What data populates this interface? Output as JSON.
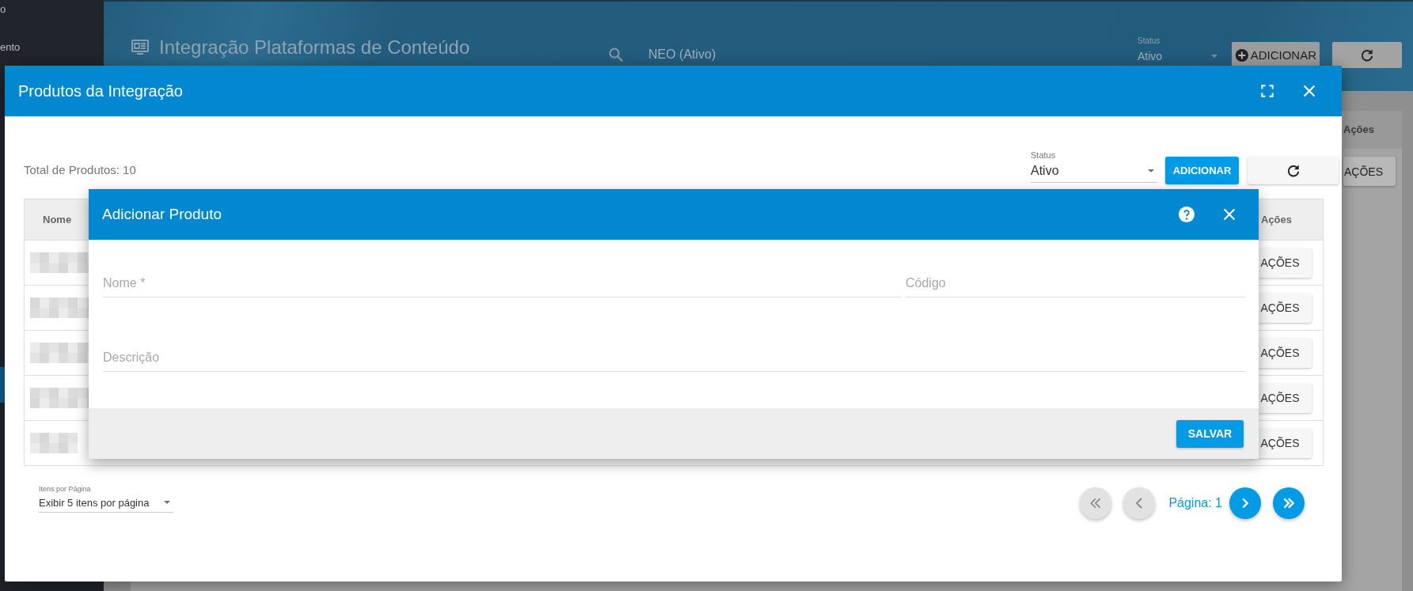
{
  "sidebar": {
    "items": [
      {
        "label": "o",
        "selected": false
      },
      {
        "label": "ento",
        "selected": false
      },
      {
        "selected": true
      }
    ]
  },
  "page": {
    "title": "Integração Plataformas de Conteúdo",
    "search_value": "NEO (Ativo)",
    "status": {
      "label": "Status",
      "value": "Ativo"
    },
    "add_button": "ADICIONAR",
    "table": {
      "columns": [
        "Ações"
      ],
      "rows": [
        {
          "action": "AÇÕES"
        }
      ]
    }
  },
  "products_dialog": {
    "title": "Produtos da Integração",
    "total": "Total de Produtos: 10",
    "status": {
      "label": "Status",
      "value": "Ativo"
    },
    "add_button": "ADICIONAR",
    "table": {
      "columns": [
        "Nome",
        "Ações"
      ],
      "rows": [
        {
          "action": "AÇÕES"
        },
        {
          "action": "AÇÕES"
        },
        {
          "action": "AÇÕES"
        },
        {
          "action": "AÇÕES"
        },
        {
          "action": "AÇÕES"
        }
      ]
    },
    "page_size": {
      "label": "Itens por Página",
      "value": "Exibir 5 itens por página"
    },
    "pagination": [
      {
        "kind": "first",
        "disabled": true
      },
      {
        "kind": "prev",
        "disabled": true
      },
      {
        "kind": "label",
        "text": "Página: 1"
      },
      {
        "kind": "next",
        "disabled": false
      },
      {
        "kind": "last",
        "disabled": false
      }
    ]
  },
  "add_dialog": {
    "title": "Adicionar Produto",
    "fields": [
      {
        "placeholder": "Nome *"
      },
      {
        "placeholder": "Código"
      },
      {
        "placeholder": "Descrição"
      }
    ],
    "save_button": "SALVAR"
  }
}
